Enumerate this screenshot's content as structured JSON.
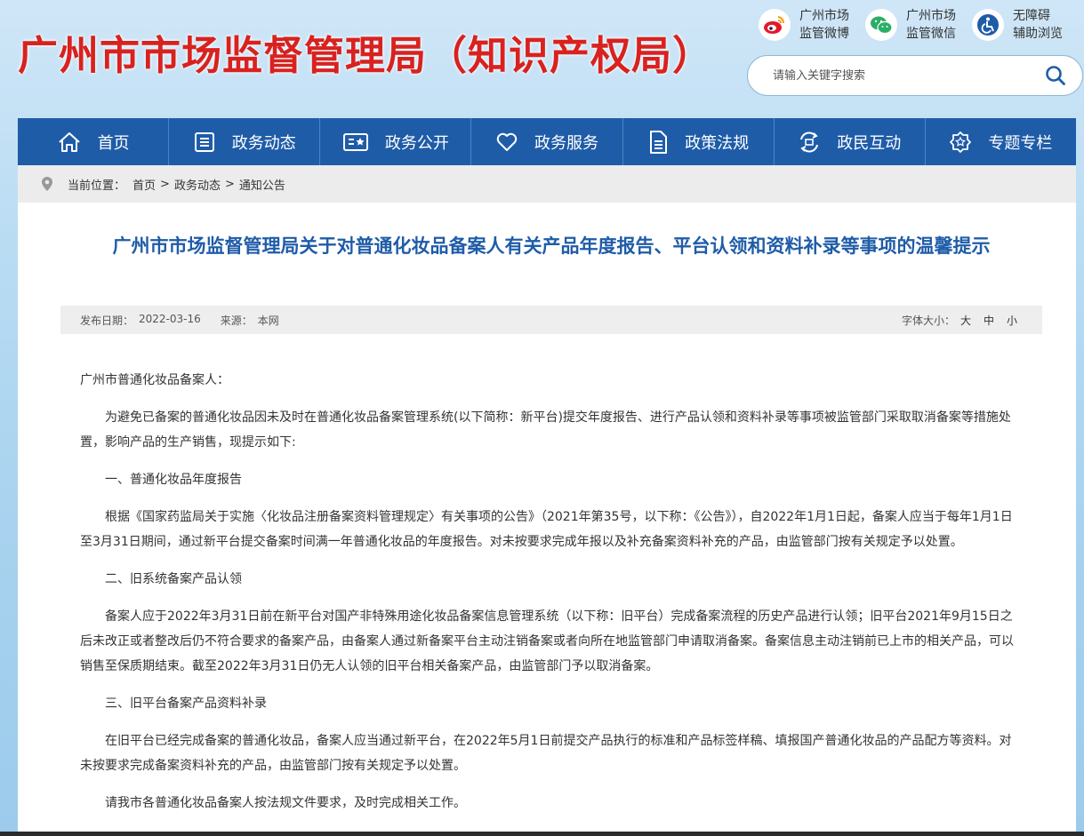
{
  "header": {
    "site_title": "广州市市场监督管理局（知识产权局）",
    "links": [
      {
        "line1": "广州市场",
        "line2": "监管微博",
        "icon": "weibo-icon"
      },
      {
        "line1": "广州市场",
        "line2": "监管微信",
        "icon": "wechat-icon"
      },
      {
        "line1": "无障碍",
        "line2": "辅助浏览",
        "icon": "accessibility-icon"
      }
    ],
    "search_placeholder": "请输入关键字搜索"
  },
  "nav": [
    {
      "label": "首页",
      "icon": "home-icon"
    },
    {
      "label": "政务动态",
      "icon": "news-icon"
    },
    {
      "label": "政务公开",
      "icon": "open-affairs-icon"
    },
    {
      "label": "政务服务",
      "icon": "heart-icon"
    },
    {
      "label": "政策法规",
      "icon": "document-icon"
    },
    {
      "label": "政民互动",
      "icon": "interaction-icon"
    },
    {
      "label": "专题专栏",
      "icon": "star-badge-icon"
    }
  ],
  "breadcrumb": {
    "prefix": "当前位置：",
    "items": [
      "首页",
      "政务动态",
      "通知公告"
    ],
    "separator": ">"
  },
  "article": {
    "title": "广州市市场监督管理局关于对普通化妆品备案人有关产品年度报告、平台认领和资料补录等事项的温馨提示",
    "publish_label": "发布日期：",
    "publish_date": "2022-03-16",
    "source_label": "来源：",
    "source": "本网",
    "font_size_label": "字体大小：",
    "font_sizes": [
      "大",
      "中",
      "小"
    ],
    "paragraphs": [
      "广州市普通化妆品备案人：",
      "为避免已备案的普通化妆品因未及时在普通化妆品备案管理系统(以下简称：新平台)提交年度报告、进行产品认领和资料补录等事项被监管部门采取取消备案等措施处置，影响产品的生产销售，现提示如下:",
      "一、普通化妆品年度报告",
      "根据《国家药监局关于实施〈化妆品注册备案资料管理规定〉有关事项的公告》（2021年第35号，以下称：《公告》），自2022年1月1日起，备案人应当于每年1月1日至3月31日期间，通过新平台提交备案时间满一年普通化妆品的年度报告。对未按要求完成年报以及补充备案资料补充的产品，由监管部门按有关规定予以处置。",
      "二、旧系统备案产品认领",
      "备案人应于2022年3月31日前在新平台对国产非特殊用途化妆品备案信息管理系统（以下称：旧平台）完成备案流程的历史产品进行认领；旧平台2021年9月15日之后未改正或者整改后仍不符合要求的备案产品，由备案人通过新备案平台主动注销备案或者向所在地监管部门申请取消备案。备案信息主动注销前已上市的相关产品，可以销售至保质期结束。截至2022年3月31日仍无人认领的旧平台相关备案产品，由监管部门予以取消备案。",
      "三、旧平台备案产品资料补录",
      "在旧平台已经完成备案的普通化妆品，备案人应当通过新平台，在2022年5月1日前提交产品执行的标准和产品标签样稿、填报国产普通化妆品的产品配方等资料。对未按要求完成备案资料补充的产品，由监管部门按有关规定予以处置。",
      "请我市各普通化妆品备案人按法规文件要求，及时完成相关工作。"
    ]
  },
  "colors": {
    "title_red": "#d8221f",
    "nav_blue": "#1f5ca8",
    "article_title_blue": "#1f5ca8",
    "weibo_red": "#e6162d",
    "wechat_green": "#2aae67",
    "accessibility_blue": "#1f5ca8"
  }
}
